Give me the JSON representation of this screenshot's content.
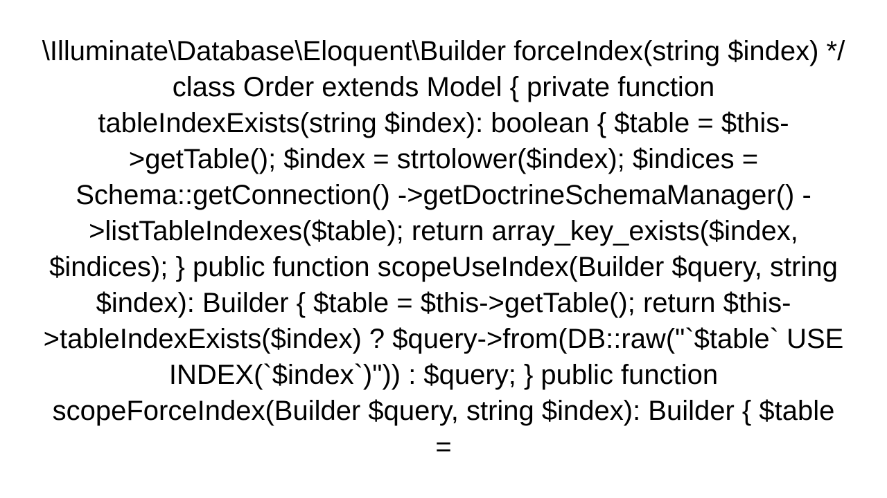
{
  "code": {
    "text": "\\Illuminate\\Database\\Eloquent\\Builder forceIndex(string $index)  */ class Order extends Model {     private function tableIndexExists(string $index): boolean     {         $table = $this->getTable();          $index = strtolower($index);          $indices = Schema::getConnection()             ->getDoctrineSchemaManager()             ->listTableIndexes($table);          return array_key_exists($index, $indices);     }      public function scopeUseIndex(Builder $query, string $index): Builder     {         $table = $this->getTable();          return $this->tableIndexExists($index)             ? $query->from(DB::raw(\"`$table` USE INDEX(`$index`)\"))             : $query;     }      public function scopeForceIndex(Builder $query, string $index): Builder     {         $table ="
  }
}
